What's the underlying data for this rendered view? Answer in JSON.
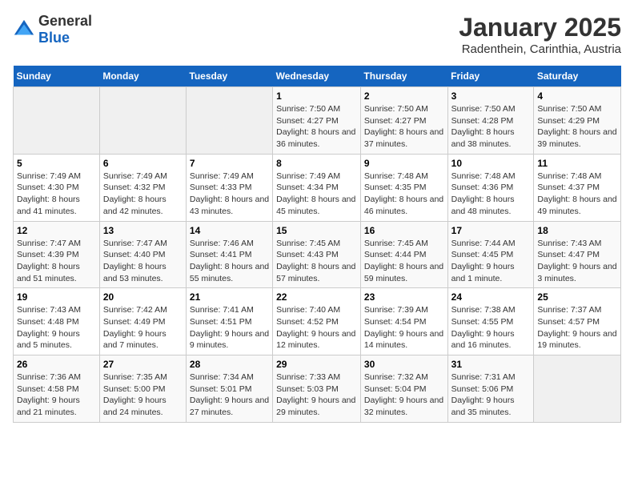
{
  "header": {
    "logo_general": "General",
    "logo_blue": "Blue",
    "month_title": "January 2025",
    "subtitle": "Radenthein, Carinthia, Austria"
  },
  "weekdays": [
    "Sunday",
    "Monday",
    "Tuesday",
    "Wednesday",
    "Thursday",
    "Friday",
    "Saturday"
  ],
  "weeks": [
    [
      {
        "day": "",
        "info": ""
      },
      {
        "day": "",
        "info": ""
      },
      {
        "day": "",
        "info": ""
      },
      {
        "day": "1",
        "info": "Sunrise: 7:50 AM\nSunset: 4:27 PM\nDaylight: 8 hours and 36 minutes."
      },
      {
        "day": "2",
        "info": "Sunrise: 7:50 AM\nSunset: 4:27 PM\nDaylight: 8 hours and 37 minutes."
      },
      {
        "day": "3",
        "info": "Sunrise: 7:50 AM\nSunset: 4:28 PM\nDaylight: 8 hours and 38 minutes."
      },
      {
        "day": "4",
        "info": "Sunrise: 7:50 AM\nSunset: 4:29 PM\nDaylight: 8 hours and 39 minutes."
      }
    ],
    [
      {
        "day": "5",
        "info": "Sunrise: 7:49 AM\nSunset: 4:30 PM\nDaylight: 8 hours and 41 minutes."
      },
      {
        "day": "6",
        "info": "Sunrise: 7:49 AM\nSunset: 4:32 PM\nDaylight: 8 hours and 42 minutes."
      },
      {
        "day": "7",
        "info": "Sunrise: 7:49 AM\nSunset: 4:33 PM\nDaylight: 8 hours and 43 minutes."
      },
      {
        "day": "8",
        "info": "Sunrise: 7:49 AM\nSunset: 4:34 PM\nDaylight: 8 hours and 45 minutes."
      },
      {
        "day": "9",
        "info": "Sunrise: 7:48 AM\nSunset: 4:35 PM\nDaylight: 8 hours and 46 minutes."
      },
      {
        "day": "10",
        "info": "Sunrise: 7:48 AM\nSunset: 4:36 PM\nDaylight: 8 hours and 48 minutes."
      },
      {
        "day": "11",
        "info": "Sunrise: 7:48 AM\nSunset: 4:37 PM\nDaylight: 8 hours and 49 minutes."
      }
    ],
    [
      {
        "day": "12",
        "info": "Sunrise: 7:47 AM\nSunset: 4:39 PM\nDaylight: 8 hours and 51 minutes."
      },
      {
        "day": "13",
        "info": "Sunrise: 7:47 AM\nSunset: 4:40 PM\nDaylight: 8 hours and 53 minutes."
      },
      {
        "day": "14",
        "info": "Sunrise: 7:46 AM\nSunset: 4:41 PM\nDaylight: 8 hours and 55 minutes."
      },
      {
        "day": "15",
        "info": "Sunrise: 7:45 AM\nSunset: 4:43 PM\nDaylight: 8 hours and 57 minutes."
      },
      {
        "day": "16",
        "info": "Sunrise: 7:45 AM\nSunset: 4:44 PM\nDaylight: 8 hours and 59 minutes."
      },
      {
        "day": "17",
        "info": "Sunrise: 7:44 AM\nSunset: 4:45 PM\nDaylight: 9 hours and 1 minute."
      },
      {
        "day": "18",
        "info": "Sunrise: 7:43 AM\nSunset: 4:47 PM\nDaylight: 9 hours and 3 minutes."
      }
    ],
    [
      {
        "day": "19",
        "info": "Sunrise: 7:43 AM\nSunset: 4:48 PM\nDaylight: 9 hours and 5 minutes."
      },
      {
        "day": "20",
        "info": "Sunrise: 7:42 AM\nSunset: 4:49 PM\nDaylight: 9 hours and 7 minutes."
      },
      {
        "day": "21",
        "info": "Sunrise: 7:41 AM\nSunset: 4:51 PM\nDaylight: 9 hours and 9 minutes."
      },
      {
        "day": "22",
        "info": "Sunrise: 7:40 AM\nSunset: 4:52 PM\nDaylight: 9 hours and 12 minutes."
      },
      {
        "day": "23",
        "info": "Sunrise: 7:39 AM\nSunset: 4:54 PM\nDaylight: 9 hours and 14 minutes."
      },
      {
        "day": "24",
        "info": "Sunrise: 7:38 AM\nSunset: 4:55 PM\nDaylight: 9 hours and 16 minutes."
      },
      {
        "day": "25",
        "info": "Sunrise: 7:37 AM\nSunset: 4:57 PM\nDaylight: 9 hours and 19 minutes."
      }
    ],
    [
      {
        "day": "26",
        "info": "Sunrise: 7:36 AM\nSunset: 4:58 PM\nDaylight: 9 hours and 21 minutes."
      },
      {
        "day": "27",
        "info": "Sunrise: 7:35 AM\nSunset: 5:00 PM\nDaylight: 9 hours and 24 minutes."
      },
      {
        "day": "28",
        "info": "Sunrise: 7:34 AM\nSunset: 5:01 PM\nDaylight: 9 hours and 27 minutes."
      },
      {
        "day": "29",
        "info": "Sunrise: 7:33 AM\nSunset: 5:03 PM\nDaylight: 9 hours and 29 minutes."
      },
      {
        "day": "30",
        "info": "Sunrise: 7:32 AM\nSunset: 5:04 PM\nDaylight: 9 hours and 32 minutes."
      },
      {
        "day": "31",
        "info": "Sunrise: 7:31 AM\nSunset: 5:06 PM\nDaylight: 9 hours and 35 minutes."
      },
      {
        "day": "",
        "info": ""
      }
    ]
  ]
}
